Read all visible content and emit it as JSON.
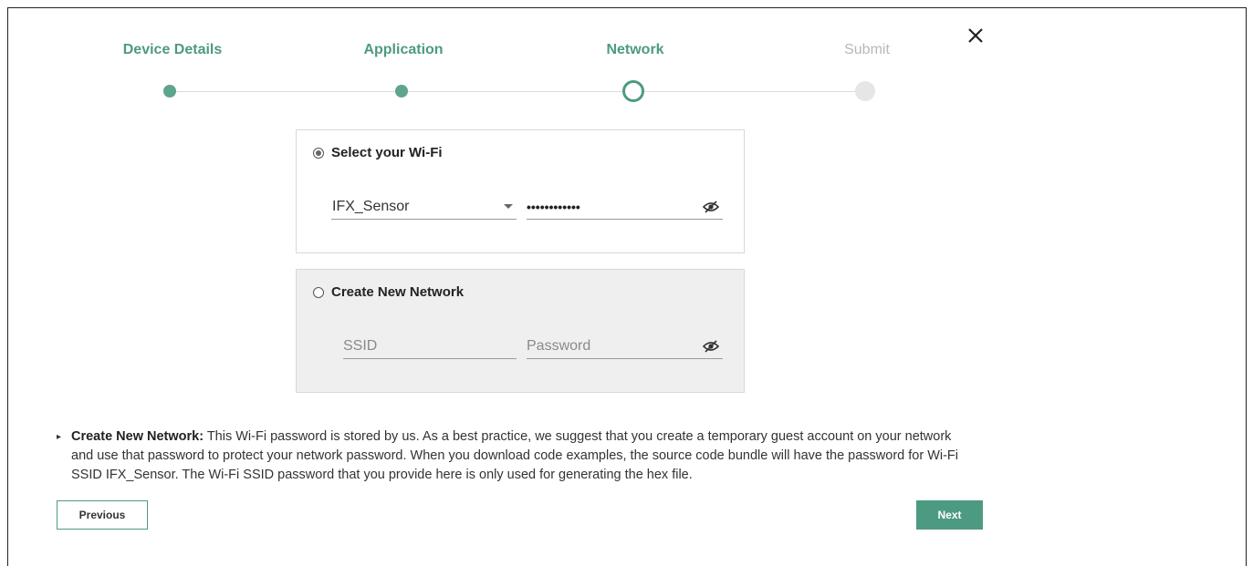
{
  "dialog": {
    "close_icon": "close-icon"
  },
  "stepper": {
    "steps": [
      {
        "label": "Device Details",
        "state": "complete"
      },
      {
        "label": "Application",
        "state": "complete"
      },
      {
        "label": "Network",
        "state": "current"
      },
      {
        "label": "Submit",
        "state": "pending"
      }
    ],
    "accent_color": "#4d9a82"
  },
  "select_wifi": {
    "radio_label": "Select your Wi-Fi",
    "selected": true,
    "ssid_value": "IFX_Sensor",
    "password_masked": "••••••••••••",
    "eye_icon": "eye-off-icon"
  },
  "create_network": {
    "radio_label": "Create New Network",
    "selected": false,
    "ssid_placeholder": "SSID",
    "password_placeholder": "Password",
    "eye_icon": "eye-off-icon"
  },
  "note": {
    "title": "Create New Network:",
    "body": " This Wi-Fi password is stored by us. As a best practice, we suggest that you create a temporary guest account on your network and use that password to protect your network password. When you download code examples, the source code bundle will have the password for Wi-Fi SSID IFX_Sensor. The Wi-Fi SSID password that you provide here is only used for generating the hex file."
  },
  "actions": {
    "previous_label": "Previous",
    "next_label": "Next"
  }
}
